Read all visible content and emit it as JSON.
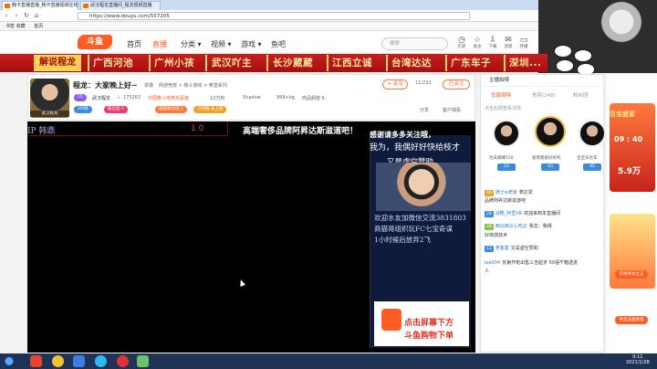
{
  "browser": {
    "tabs": [
      {
        "label": "韩卡直播直播_韩卡直播视频在线"
      },
      {
        "label": "武汉程龙直播间_程龙视频直播"
      }
    ],
    "nav": {
      "back": "‹",
      "forward": "›",
      "refresh": "↻",
      "home": "⌂"
    },
    "url": "https://www.douyu.com/557205",
    "bookmarks": [
      "书签 收藏",
      "首页"
    ]
  },
  "site": {
    "logo_text": "斗鱼",
    "nav": [
      "首页",
      "直播",
      "分类 ▾",
      "视频 ▾",
      "游戏 ▾",
      "鱼吧"
    ],
    "search_placeholder": "搜索",
    "header_icons": [
      {
        "icon": "history-icon",
        "glyph": "◷",
        "label": "历史"
      },
      {
        "icon": "follow-icon",
        "glyph": "☆",
        "label": "关注"
      },
      {
        "icon": "download-icon",
        "glyph": "⇩",
        "label": "下载"
      },
      {
        "icon": "message-icon",
        "glyph": "✉",
        "label": "消息"
      },
      {
        "icon": "broadcast-icon",
        "glyph": "▭",
        "label": "开播"
      },
      {
        "icon": "avatar-icon",
        "glyph": "☺",
        "label": ""
      }
    ]
  },
  "banner": {
    "first": "解说程龙",
    "items": [
      "广西河池",
      "广州小孩",
      "武汉吖主",
      "长沙葳葳",
      "江西立诚",
      "台湾达达",
      "广东车子",
      "深圳..."
    ]
  },
  "room": {
    "title": "程龙：大家晚上好~",
    "report": "举报",
    "category": "网游竞技 > 格斗游戏 > 拳皇系列",
    "level_badge": "55",
    "nick": "武汉程龙",
    "hot_count": "175263",
    "rank_tag": "中国格斗电竞先驱者",
    "fans": "12万粉",
    "shadow": "Shadow",
    "weight": "999+kg",
    "goods": "商品橱窗 6",
    "follow_button": "+ 关注",
    "follow_count": "11/232",
    "join_button": "已关注",
    "vip_badge": "VIP榜",
    "badges": [
      {
        "label": "粉丝团 0",
        "color": "#e83e6c"
      },
      {
        "label": "超级粉丝团 1",
        "color": "#ff7a3d"
      },
      {
        "label": "小时榜 未上榜",
        "color": "#f0a12d"
      }
    ],
    "share": "分享",
    "client": "客户端看"
  },
  "video": {
    "ip_line": "IP 韩鼎",
    "ten_line": "1 0",
    "ticker": "高端奢侈品牌阿昇达斯滋道吧！",
    "overlay_top": "感谢请多多关注哦，",
    "overlay_line2": "我为，我偶好好快给枝才",
    "overlay_line3": "又是虚空赞助",
    "overlay_texts": [
      "欢迎水友加微信交流3831803",
      "商猫哥组织玩FC七宝奇谋",
      "1小时候后放弃2飞"
    ],
    "ad_line1": "点击屏幕下方",
    "ad_line2": "斗鱼购物下单"
  },
  "chatpanel": {
    "header": "主播拍榜",
    "tabs": [
      "贡献周榜",
      "贵宾(248)",
      "粉丝团"
    ],
    "sub": "点击右侧查看详情",
    "top3": [
      {
        "name": "功夫巅峰550",
        "level": "23"
      },
      {
        "name": "极简我爱好好利",
        "level": "43"
      },
      {
        "name": "宝宝天达年",
        "level": "45"
      }
    ],
    "messages": [
      {
        "badge": "40",
        "badgecolor": "#f0a12d",
        "name": "骑士w老板",
        "text": "表达爱"
      },
      {
        "badge": "",
        "badgecolor": "",
        "name": "",
        "text": "品牌阿昇达斯滋道吧"
      },
      {
        "badge": "28",
        "badgecolor": "#3b8be0",
        "name": "战略_阿里VR",
        "text": "欢迎来到本直播间"
      },
      {
        "badge": "28",
        "badgecolor": "#8bc34a",
        "name": "西瓜西瓜心吃瓜",
        "text": "我龙：我得"
      },
      {
        "badge": "",
        "badgecolor": "",
        "name": "",
        "text": "好体感技术"
      },
      {
        "badge": "12",
        "badgecolor": "#3b8be0",
        "name": "老客套",
        "text": "又是虚空赞助"
      },
      {
        "badge": "",
        "badgecolor": "",
        "name": "lee004",
        "text": "瓦第开枪出售三吉起步 50语千箱送进"
      },
      {
        "badge": "",
        "badgecolor": "",
        "name": "",
        "text": "人"
      }
    ]
  },
  "sidead": {
    "title": "百宝盛宴",
    "timer": "09 : 40",
    "prize": "5.9万",
    "btn1": "召唤神龙之王",
    "btn2": "神兵法器降临"
  },
  "taskbar": {
    "time": "0:11",
    "date": "2021/1/28"
  }
}
